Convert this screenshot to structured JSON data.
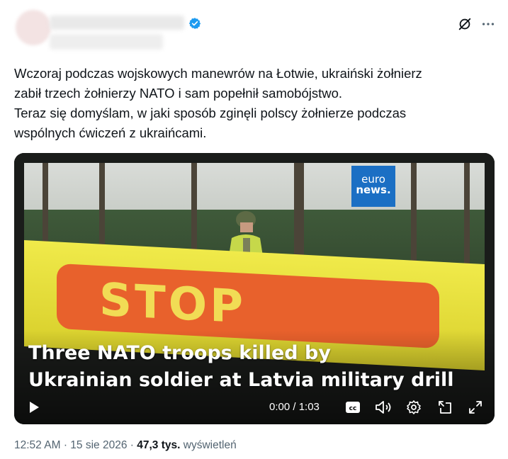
{
  "tweet": {
    "text_lines": [
      "Wczoraj podczas wojskowych manewrów na Łotwie, ukraiński żołnierz",
      "zabił trzech żołnierzy NATO i sam popełnił samobójstwo.",
      "Teraz się domyślam, w jaki sposób zginęli polscy żołnierze podczas",
      "wspólnych ćwiczeń z ukraińcami."
    ],
    "time": "12:52 AM",
    "date": "15 sie 2026",
    "views_count": "47,3 tys.",
    "views_label": "wyświetleń",
    "separator": "·"
  },
  "video": {
    "logo_line1": "euro",
    "logo_line2": "news.",
    "sign_text": "STOP",
    "headline_line1": "Three NATO troops killed by",
    "headline_line2": "Ukrainian soldier at Latvia military drill",
    "time_display": "0:00 / 1:03",
    "cc_label": "cc"
  },
  "colors": {
    "verified": "#1d9bf0",
    "text": "#0f1419",
    "muted": "#536471",
    "euronews": "#1b6fc4"
  }
}
